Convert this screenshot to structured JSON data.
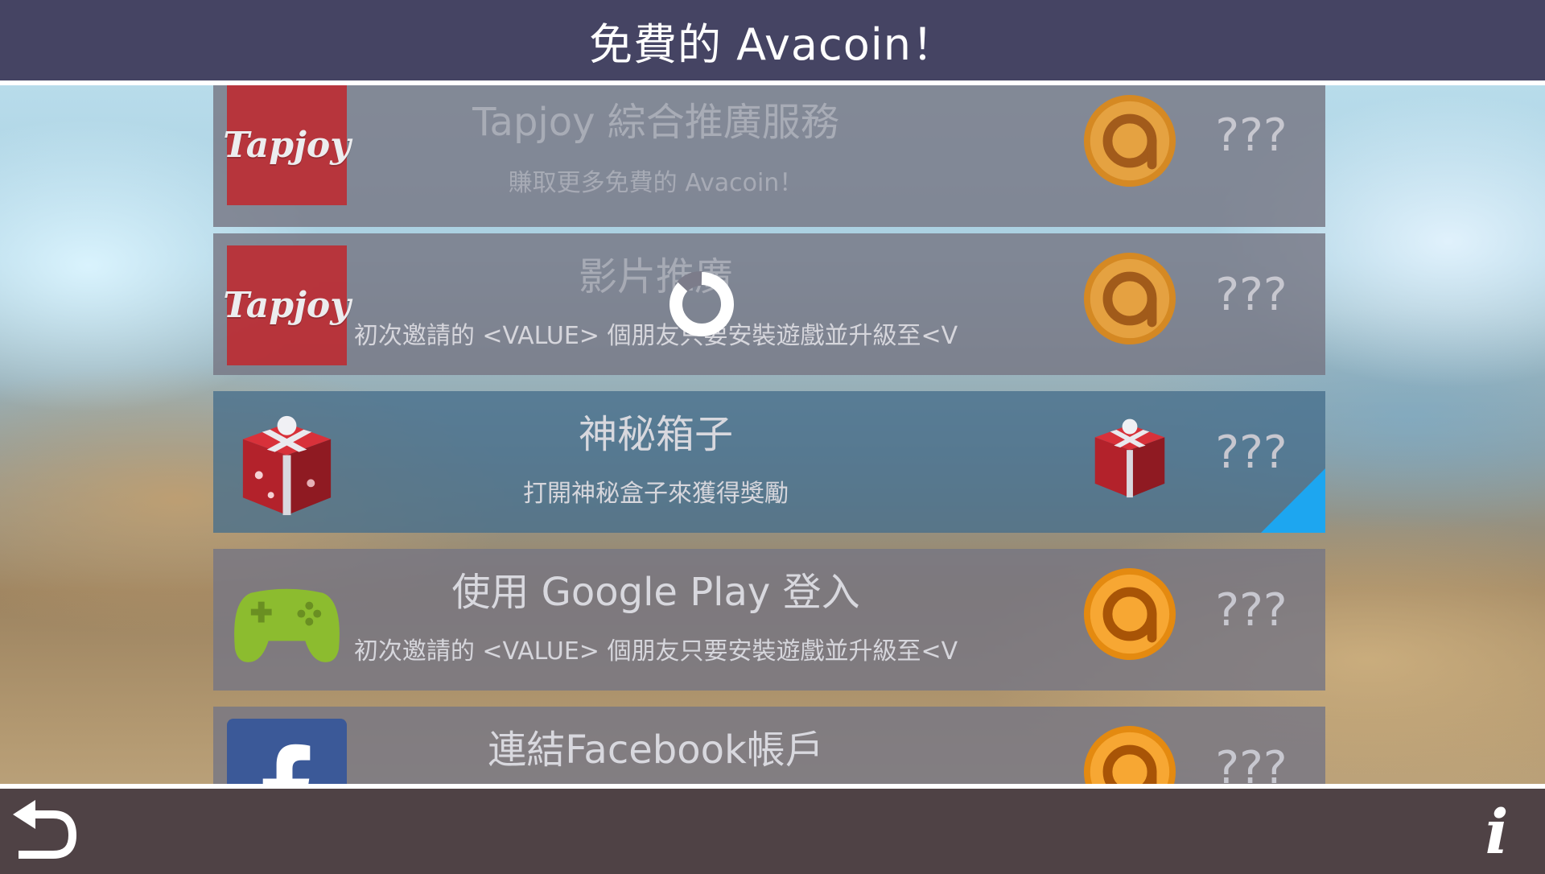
{
  "header": {
    "title": "免費的 Avacoin！"
  },
  "offers": [
    {
      "title": "Tapjoy 綜合推廣服務",
      "subtitle": "賺取更多免費的 Avacoin！",
      "logo_text": "Tapjoy",
      "reward": "???",
      "thumb_icon": "tapjoy-logo",
      "reward_icon": "avacoin-icon",
      "state": "faded"
    },
    {
      "title": "影片推廣",
      "subtitle": "初次邀請的 <VALUE> 個朋友只要安裝遊戲並升級至<V",
      "logo_text": "Tapjoy",
      "reward": "???",
      "thumb_icon": "tapjoy-logo",
      "reward_icon": "avacoin-icon",
      "state": "loading"
    },
    {
      "title": "神秘箱子",
      "subtitle": "打開神秘盒子來獲得獎勵",
      "reward": "???",
      "thumb_icon": "mystery-gift-icon",
      "reward_icon": "mystery-gift-icon",
      "state": "selected"
    },
    {
      "title": "使用 Google Play 登入",
      "subtitle": "初次邀請的 <VALUE> 個朋友只要安裝遊戲並升級至<V",
      "reward": "???",
      "thumb_icon": "gamepad-icon",
      "reward_icon": "avacoin-icon",
      "state": "normal"
    },
    {
      "title": "連結Facebook帳戶",
      "subtitle": "",
      "reward": "???",
      "thumb_icon": "facebook-icon",
      "reward_icon": "avacoin-icon",
      "state": "partial"
    }
  ],
  "footer": {
    "back_icon": "back-arrow-icon",
    "info_label": "i"
  },
  "colors": {
    "header_bg": "#454463",
    "footer_bg": "#4f4245",
    "selected_flag": "#1da6f0",
    "tapjoy_red": "#c1272d",
    "coin_orange": "#f29b1b",
    "gamepad_green": "#8cbc2f",
    "facebook_blue": "#3b5998"
  }
}
